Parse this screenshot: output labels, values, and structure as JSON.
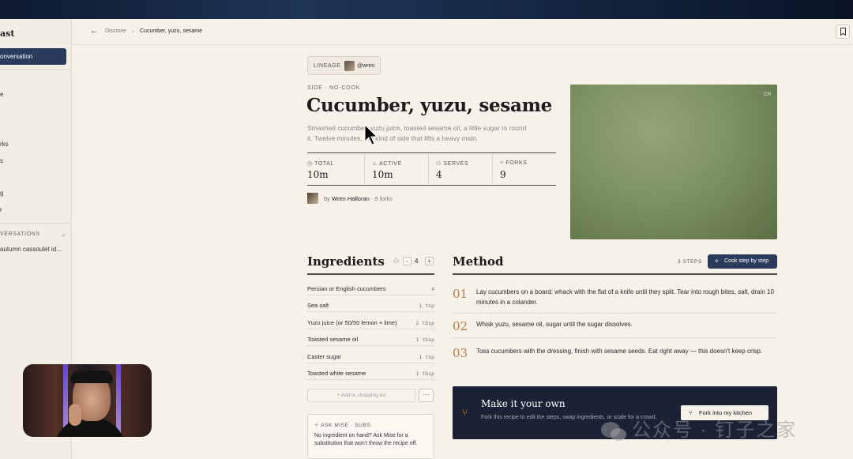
{
  "sidebar": {
    "title": "ast",
    "new_conversation": "onversation",
    "items": [
      "e",
      "rks",
      "s",
      "g",
      "r"
    ],
    "conversations_header": "VERSATIONS",
    "conversation_item": "autumn cassoulet id..."
  },
  "breadcrumb": {
    "parent": "Discover",
    "current": "Cucumber, yuzu, sesame"
  },
  "lineage": {
    "label": "LINEAGE",
    "handle": "@wren"
  },
  "recipe": {
    "kicker": "SIDE · NO-COOK",
    "title": "Cucumber, yuzu, sesame",
    "description": "Smashed cucumber, yuzu juice, toasted sesame oil, a little sugar to round it. Twelve minutes, the kind of side that lifts a heavy main.",
    "stats": [
      {
        "icon": "clock-icon",
        "label": "TOTAL",
        "value": "10m"
      },
      {
        "icon": "flame-icon",
        "label": "ACTIVE",
        "value": "10m"
      },
      {
        "icon": "people-icon",
        "label": "SERVES",
        "value": "4"
      },
      {
        "icon": "fork-icon",
        "label": "FORKS",
        "value": "9"
      }
    ],
    "author_by": "by",
    "author_name": "Wren Halloran",
    "fork_count": "· 9 forks",
    "hero_tag": "CH"
  },
  "ingredients": {
    "title": "Ingredients",
    "servings": "4",
    "items": [
      {
        "name": "Persian or English cucumbers",
        "qty": "4"
      },
      {
        "name": "Sea salt",
        "qty": "1 tsp"
      },
      {
        "name": "Yuzu juice (or 50/50 lemon + lime)",
        "qty": "2 tbsp"
      },
      {
        "name": "Toasted sesame oil",
        "qty": "1 tbsp"
      },
      {
        "name": "Caster sugar",
        "qty": "1 tsp"
      },
      {
        "name": "Toasted white sesame",
        "qty": "1 tbsp"
      }
    ],
    "add_to_list": "+ Add to shopping list",
    "more": "···"
  },
  "mise": {
    "header": "ASK MISE · SUBS",
    "text": "No ingredient on hand? Ask Mise for a substitution that won't throw the recipe off."
  },
  "method": {
    "title": "Method",
    "steps_count": "3 STEPS",
    "cook_button": "Cook step by step",
    "steps": [
      {
        "num": "01",
        "text": "Lay cucumbers on a board; whack with the flat of a knife until they split. Tear into rough bites, salt, drain 10 minutes in a colander."
      },
      {
        "num": "02",
        "text": "Whisk yuzu, sesame oil, sugar until the sugar dissolves."
      },
      {
        "num": "03",
        "text": "Toss cucumbers with the dressing, finish with sesame seeds. Eat right away — this doesn't keep crisp."
      }
    ]
  },
  "fork_panel": {
    "title": "Make it your own",
    "description": "Fork this recipe to edit the steps, swap ingredients, or scale for a crowd.",
    "button": "Fork into my kitchen"
  },
  "watermark": "公众号 · 钉子之家",
  "colors": {
    "accent_navy": "#2d3b5a",
    "step_number": "#b87a4b",
    "background": "#f6f1e9"
  }
}
